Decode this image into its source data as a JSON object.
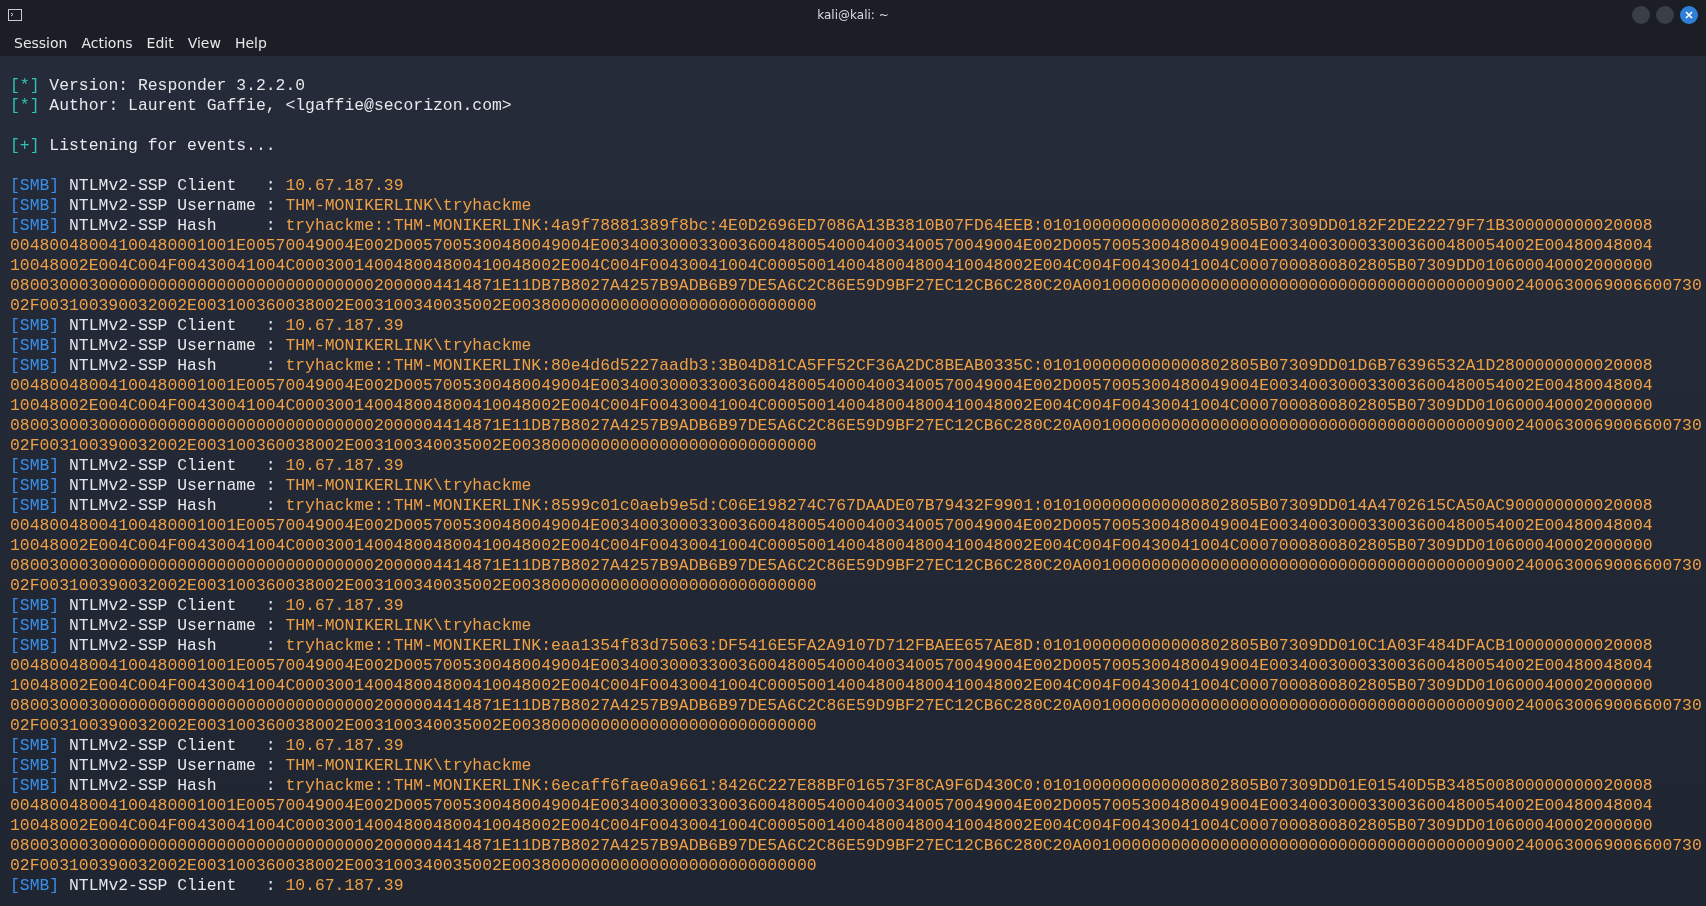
{
  "window": {
    "title": "kali@kali: ~"
  },
  "menu": [
    "Session",
    "Actions",
    "Edit",
    "View",
    "Help"
  ],
  "lines": [
    {
      "kind": "info",
      "tag": "[*]",
      "text": "Version: Responder 3.2.2.0"
    },
    {
      "kind": "info",
      "tag": "[*]",
      "text": "Author: Laurent Gaffie, <lgaffie@secorizon.com>"
    },
    {
      "kind": "blank"
    },
    {
      "kind": "status",
      "tag": "[+]",
      "text": "Listening for events..."
    },
    {
      "kind": "blank"
    },
    {
      "kind": "smb",
      "tag": "[SMB]",
      "label": "NTLMv2-SSP Client   :",
      "value": "10.67.187.39"
    },
    {
      "kind": "smb",
      "tag": "[SMB]",
      "label": "NTLMv2-SSP Username :",
      "value": "THM-MONIKERLINK\\tryhackme"
    },
    {
      "kind": "smb",
      "tag": "[SMB]",
      "label": "NTLMv2-SSP Hash     :",
      "value": "tryhackme::THM-MONIKERLINK:4a9f78881389f8bc:4E0D2696ED7086A13B3810B07FD64EEB:0101000000000000802805B07309DD0182F2DE22279F71B300000000020008",
      "wrapped": [
        "00480048004100480001001E00570049004E002D0057005300480049004E0034003000330036004800540004003400570049004E002D0057005300480049004E003400300033003600480054002E00480048004",
        "10048002E004C004F00430041004C000300140048004800410048002E004C004F00430041004C000500140048004800410048002E004C004F00430041004C0007000800802805B07309DD010600040002000000",
        "08003000300000000000000000000000000002000004414871E11DB7B8027A4257B9ADB6B97DE5A6C2C86E59D9BF27EC12CB6C280C20A001000000000000000000000000000000000000009002400630069006600730",
        "02F003100390032002E003100360038002E003100340035002E0038000000000000000000000000000"
      ]
    },
    {
      "kind": "smb",
      "tag": "[SMB]",
      "label": "NTLMv2-SSP Client   :",
      "value": "10.67.187.39"
    },
    {
      "kind": "smb",
      "tag": "[SMB]",
      "label": "NTLMv2-SSP Username :",
      "value": "THM-MONIKERLINK\\tryhackme"
    },
    {
      "kind": "smb",
      "tag": "[SMB]",
      "label": "NTLMv2-SSP Hash     :",
      "value": "tryhackme::THM-MONIKERLINK:80e4d6d5227aadb3:3B04D81CA5FF52CF36A2DC8BEAB0335C:0101000000000000802805B07309DD01D6B76396532A1D2800000000020008",
      "wrapped": [
        "00480048004100480001001E00570049004E002D0057005300480049004E0034003000330036004800540004003400570049004E002D0057005300480049004E003400300033003600480054002E00480048004",
        "10048002E004C004F00430041004C000300140048004800410048002E004C004F00430041004C000500140048004800410048002E004C004F00430041004C0007000800802805B07309DD010600040002000000",
        "08003000300000000000000000000000000002000004414871E11DB7B8027A4257B9ADB6B97DE5A6C2C86E59D9BF27EC12CB6C280C20A001000000000000000000000000000000000000009002400630069006600730",
        "02F003100390032002E003100360038002E003100340035002E0038000000000000000000000000000"
      ]
    },
    {
      "kind": "smb",
      "tag": "[SMB]",
      "label": "NTLMv2-SSP Client   :",
      "value": "10.67.187.39"
    },
    {
      "kind": "smb",
      "tag": "[SMB]",
      "label": "NTLMv2-SSP Username :",
      "value": "THM-MONIKERLINK\\tryhackme"
    },
    {
      "kind": "smb",
      "tag": "[SMB]",
      "label": "NTLMv2-SSP Hash     :",
      "value": "tryhackme::THM-MONIKERLINK:8599c01c0aeb9e5d:C06E198274C767DAADE07B79432F9901:0101000000000000802805B07309DD014A4702615CA50AC900000000020008",
      "wrapped": [
        "00480048004100480001001E00570049004E002D0057005300480049004E0034003000330036004800540004003400570049004E002D0057005300480049004E003400300033003600480054002E00480048004",
        "10048002E004C004F00430041004C000300140048004800410048002E004C004F00430041004C000500140048004800410048002E004C004F00430041004C0007000800802805B07309DD010600040002000000",
        "08003000300000000000000000000000000002000004414871E11DB7B8027A4257B9ADB6B97DE5A6C2C86E59D9BF27EC12CB6C280C20A001000000000000000000000000000000000000009002400630069006600730",
        "02F003100390032002E003100360038002E003100340035002E0038000000000000000000000000000"
      ]
    },
    {
      "kind": "smb",
      "tag": "[SMB]",
      "label": "NTLMv2-SSP Client   :",
      "value": "10.67.187.39"
    },
    {
      "kind": "smb",
      "tag": "[SMB]",
      "label": "NTLMv2-SSP Username :",
      "value": "THM-MONIKERLINK\\tryhackme"
    },
    {
      "kind": "smb",
      "tag": "[SMB]",
      "label": "NTLMv2-SSP Hash     :",
      "value": "tryhackme::THM-MONIKERLINK:eaa1354f83d75063:DF5416E5FA2A9107D712FBAEE657AE8D:0101000000000000802805B07309DD010C1A03F484DFACB100000000020008",
      "wrapped": [
        "00480048004100480001001E00570049004E002D0057005300480049004E0034003000330036004800540004003400570049004E002D0057005300480049004E003400300033003600480054002E00480048004",
        "10048002E004C004F00430041004C000300140048004800410048002E004C004F00430041004C000500140048004800410048002E004C004F00430041004C0007000800802805B07309DD010600040002000000",
        "08003000300000000000000000000000000002000004414871E11DB7B8027A4257B9ADB6B97DE5A6C2C86E59D9BF27EC12CB6C280C20A001000000000000000000000000000000000000009002400630069006600730",
        "02F003100390032002E003100360038002E003100340035002E0038000000000000000000000000000"
      ]
    },
    {
      "kind": "smb",
      "tag": "[SMB]",
      "label": "NTLMv2-SSP Client   :",
      "value": "10.67.187.39"
    },
    {
      "kind": "smb",
      "tag": "[SMB]",
      "label": "NTLMv2-SSP Username :",
      "value": "THM-MONIKERLINK\\tryhackme"
    },
    {
      "kind": "smb",
      "tag": "[SMB]",
      "label": "NTLMv2-SSP Hash     :",
      "value": "tryhackme::THM-MONIKERLINK:6ecaff6fae0a9661:8426C227E88BF016573F8CA9F6D430C0:0101000000000000802805B07309DD01E01540D5B348500800000000020008",
      "wrapped": [
        "00480048004100480001001E00570049004E002D0057005300480049004E0034003000330036004800540004003400570049004E002D0057005300480049004E003400300033003600480054002E00480048004",
        "10048002E004C004F00430041004C000300140048004800410048002E004C004F00430041004C000500140048004800410048002E004C004F00430041004C0007000800802805B07309DD010600040002000000",
        "08003000300000000000000000000000000002000004414871E11DB7B8027A4257B9ADB6B97DE5A6C2C86E59D9BF27EC12CB6C280C20A001000000000000000000000000000000000000009002400630069006600730",
        "02F003100390032002E003100360038002E003100340035002E0038000000000000000000000000000"
      ]
    },
    {
      "kind": "smb",
      "tag": "[SMB]",
      "label": "NTLMv2-SSP Client   :",
      "value": "10.67.187.39"
    }
  ]
}
